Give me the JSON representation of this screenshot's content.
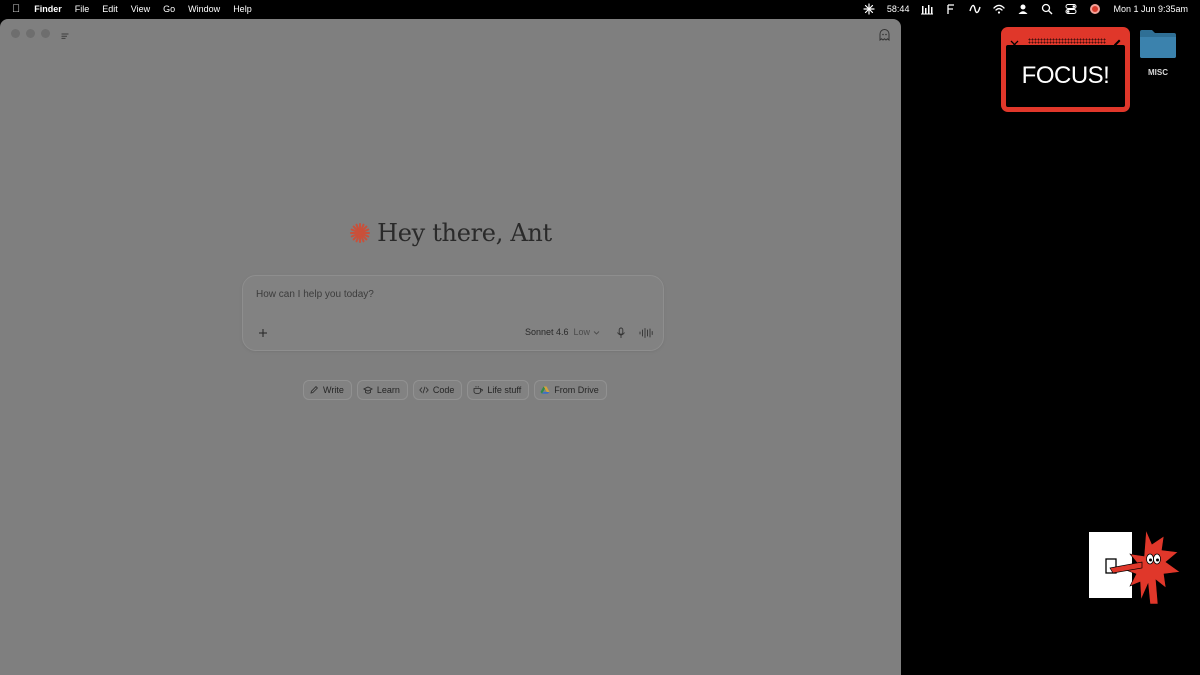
{
  "menubar": {
    "app_name": "Finder",
    "menus": [
      "File",
      "Edit",
      "View",
      "Go",
      "Window",
      "Help"
    ],
    "timer": "58:44",
    "datetime": "Mon 1 Jun  9:35am"
  },
  "main": {
    "greeting": "Hey there, Ant",
    "composer": {
      "placeholder": "How can I help you today?",
      "model": "Sonnet 4.6",
      "effort": "Low"
    },
    "chips": [
      {
        "label": "Write",
        "icon": "pencil-icon"
      },
      {
        "label": "Learn",
        "icon": "graduation-cap-icon"
      },
      {
        "label": "Code",
        "icon": "code-icon"
      },
      {
        "label": "Life stuff",
        "icon": "coffee-cup-icon"
      },
      {
        "label": "From Drive",
        "icon": "google-drive-icon"
      }
    ]
  },
  "focus_widget": {
    "text": "FOCUS!"
  },
  "desktop": {
    "folder_label": "MISC"
  },
  "colors": {
    "accent": "#d9583b",
    "focus_red": "#e0372a",
    "window_bg": "#7f7f7f",
    "folder_blue": "#2f6f95"
  }
}
